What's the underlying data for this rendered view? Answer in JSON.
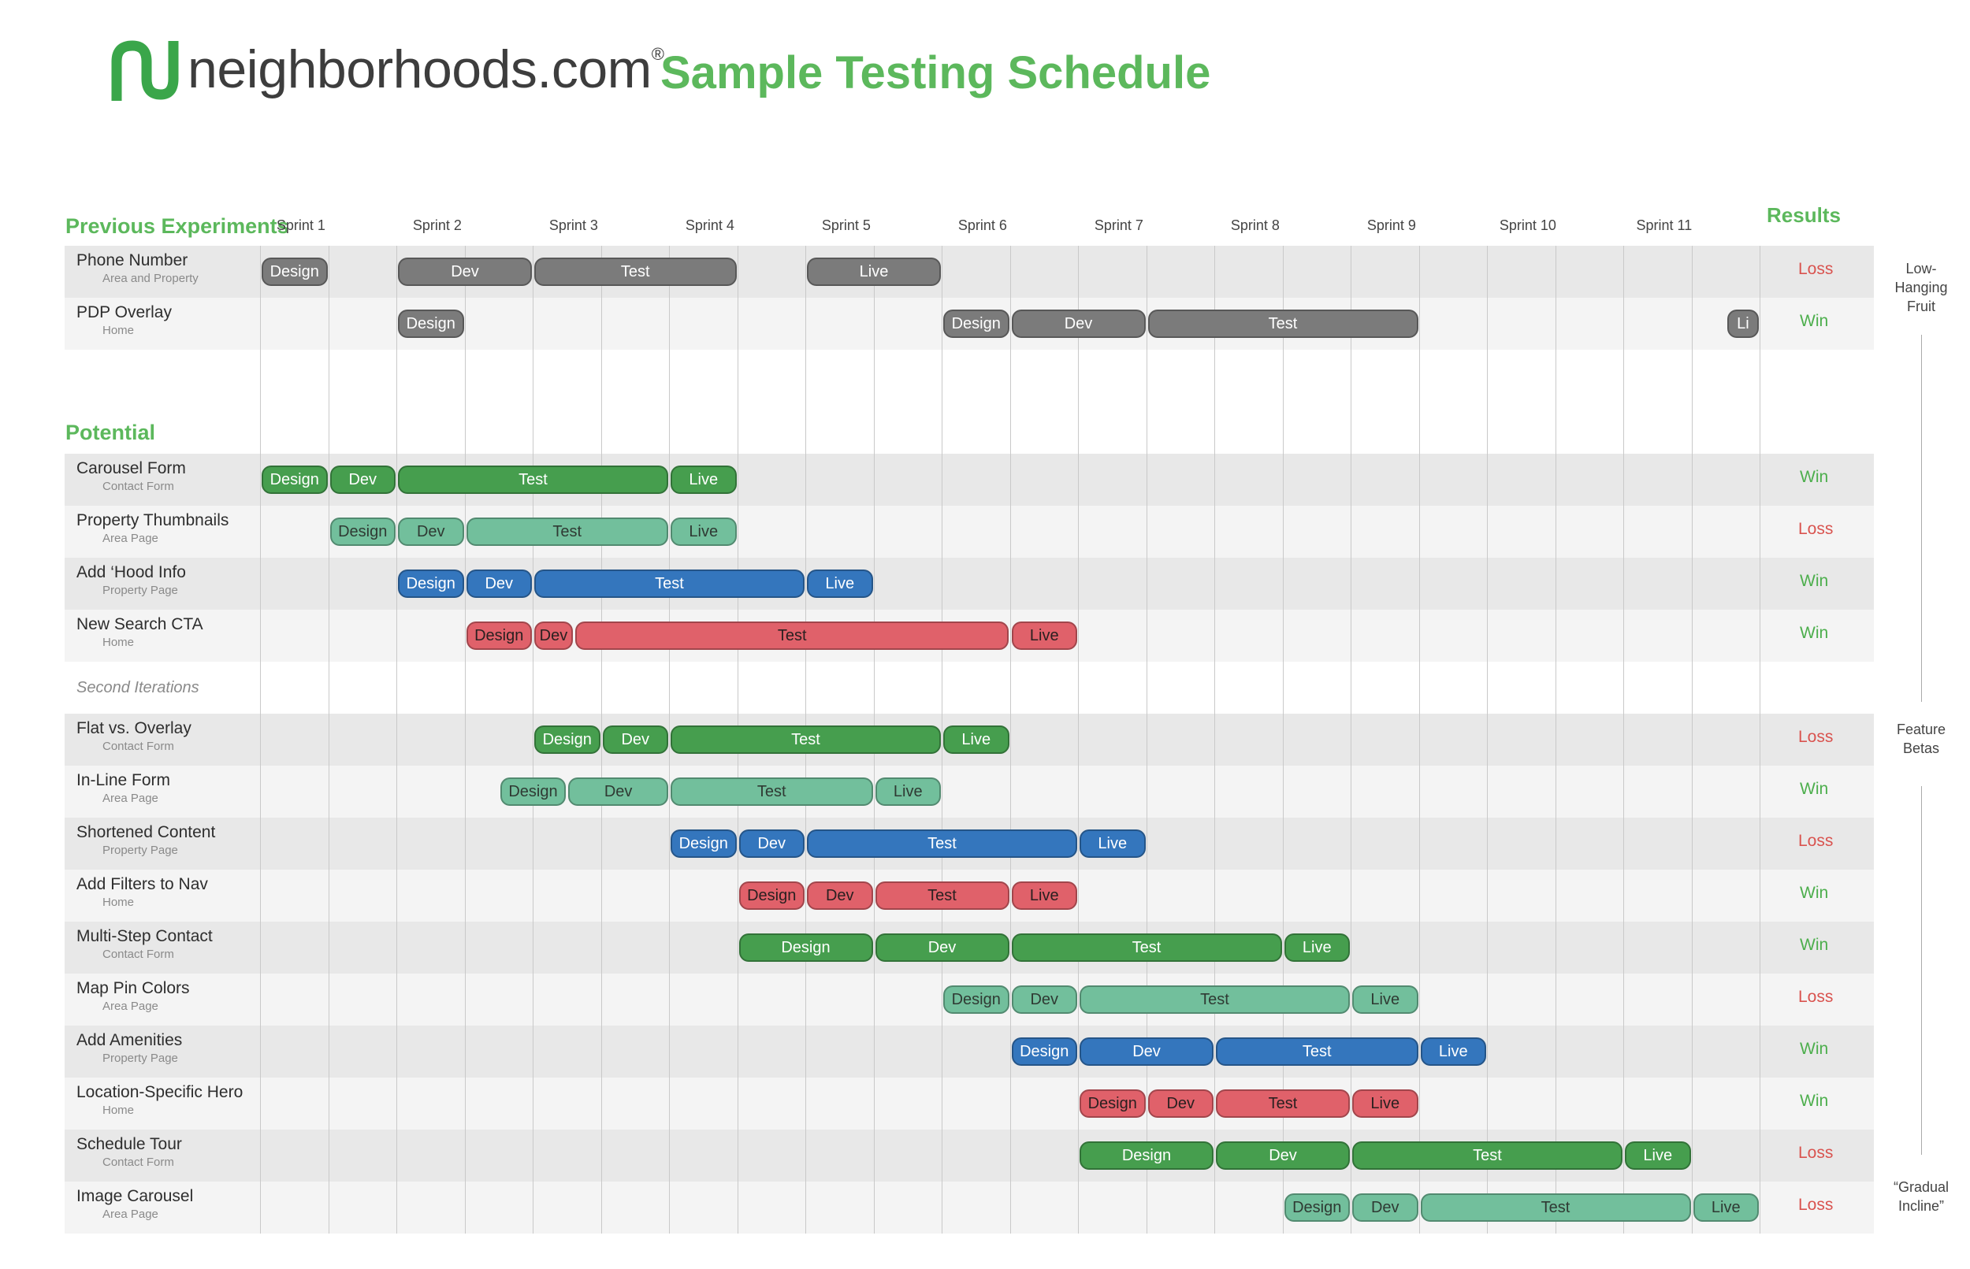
{
  "header": {
    "logo_text": "neighborhoods.com",
    "logo_mark": "®",
    "title": "Sample Testing Schedule"
  },
  "sections": {
    "previous": "Previous Experiments",
    "potential": "Potential",
    "second_iterations": "Second Iterations"
  },
  "sprints": [
    "Sprint 1",
    "Sprint 2",
    "Sprint 3",
    "Sprint 4",
    "Sprint 5",
    "Sprint 6",
    "Sprint 7",
    "Sprint 8",
    "Sprint 9",
    "Sprint 10",
    "Sprint 11"
  ],
  "results_header": "Results",
  "colors": {
    "gray": "#7b7b7b",
    "dark_green": "#469e4e",
    "light_green": "#72bf9c",
    "blue": "#3476bd",
    "red": "#e0616a",
    "win": "#4cae4c",
    "loss": "#d9534f",
    "title_green": "#5cb85c"
  },
  "rows": [
    {
      "name": "Phone Number",
      "sub": "Area and Property",
      "result": "Loss",
      "color": "gray",
      "bars": [
        {
          "label": "Design",
          "start": 0,
          "end": 0.5
        },
        {
          "label": "Dev",
          "start": 1,
          "end": 2
        },
        {
          "label": "Test",
          "start": 2,
          "end": 3.5
        },
        {
          "label": "Live",
          "start": 4,
          "end": 5
        }
      ]
    },
    {
      "name": "PDP Overlay",
      "sub": "Home",
      "result": "Win",
      "color": "gray",
      "bars": [
        {
          "label": "Design",
          "start": 1,
          "end": 1.5
        },
        {
          "label": "Design",
          "start": 5,
          "end": 5.5
        },
        {
          "label": "Dev",
          "start": 5.5,
          "end": 6.5
        },
        {
          "label": "Test",
          "start": 6.5,
          "end": 8.5
        },
        {
          "label": "Li",
          "start": 10.75,
          "end": 11
        }
      ]
    },
    {
      "name": "Carousel Form",
      "sub": "Contact Form",
      "result": "Win",
      "color": "dark_green",
      "bars": [
        {
          "label": "Design",
          "start": 0,
          "end": 0.5
        },
        {
          "label": "Dev",
          "start": 0.5,
          "end": 1
        },
        {
          "label": "Test",
          "start": 1,
          "end": 3
        },
        {
          "label": "Live",
          "start": 3,
          "end": 3.5
        }
      ]
    },
    {
      "name": "Property Thumbnails",
      "sub": "Area Page",
      "result": "Loss",
      "color": "light_green",
      "bars": [
        {
          "label": "Design",
          "start": 0.5,
          "end": 1
        },
        {
          "label": "Dev",
          "start": 1,
          "end": 1.5
        },
        {
          "label": "Test",
          "start": 1.5,
          "end": 3
        },
        {
          "label": "Live",
          "start": 3,
          "end": 3.5
        }
      ]
    },
    {
      "name": "Add ‘Hood Info",
      "sub": "Property Page",
      "result": "Win",
      "color": "blue",
      "bars": [
        {
          "label": "Design",
          "start": 1,
          "end": 1.5
        },
        {
          "label": "Dev",
          "start": 1.5,
          "end": 2
        },
        {
          "label": "Test",
          "start": 2,
          "end": 4
        },
        {
          "label": "Live",
          "start": 4,
          "end": 4.5
        }
      ]
    },
    {
      "name": "New Search CTA",
      "sub": "Home",
      "result": "Win",
      "color": "red",
      "bars": [
        {
          "label": "Design",
          "start": 1.5,
          "end": 2
        },
        {
          "label": "Dev",
          "start": 2,
          "end": 2.3
        },
        {
          "label": "Test",
          "start": 2.3,
          "end": 5.5
        },
        {
          "label": "Live",
          "start": 5.5,
          "end": 6
        }
      ]
    },
    {
      "name": "Flat vs. Overlay",
      "sub": "Contact Form",
      "result": "Loss",
      "color": "dark_green",
      "bars": [
        {
          "label": "Design",
          "start": 2,
          "end": 2.5
        },
        {
          "label": "Dev",
          "start": 2.5,
          "end": 3
        },
        {
          "label": "Test",
          "start": 3,
          "end": 5
        },
        {
          "label": "Live",
          "start": 5,
          "end": 5.5
        }
      ]
    },
    {
      "name": "In-Line Form",
      "sub": "Area Page",
      "result": "Win",
      "color": "light_green",
      "bars": [
        {
          "label": "Design",
          "start": 1.75,
          "end": 2.25
        },
        {
          "label": "Dev",
          "start": 2.25,
          "end": 3
        },
        {
          "label": "Test",
          "start": 3,
          "end": 4.5
        },
        {
          "label": "Live",
          "start": 4.5,
          "end": 5
        }
      ]
    },
    {
      "name": "Shortened Content",
      "sub": "Property Page",
      "result": "Loss",
      "color": "blue",
      "bars": [
        {
          "label": "Design",
          "start": 3,
          "end": 3.5
        },
        {
          "label": "Dev",
          "start": 3.5,
          "end": 4
        },
        {
          "label": "Test",
          "start": 4,
          "end": 6
        },
        {
          "label": "Live",
          "start": 6,
          "end": 6.5
        }
      ]
    },
    {
      "name": "Add Filters to Nav",
      "sub": "Home",
      "result": "Win",
      "color": "red",
      "bars": [
        {
          "label": "Design",
          "start": 3.5,
          "end": 4
        },
        {
          "label": "Dev",
          "start": 4,
          "end": 4.5
        },
        {
          "label": "Test",
          "start": 4.5,
          "end": 5.5
        },
        {
          "label": "Live",
          "start": 5.5,
          "end": 6
        }
      ]
    },
    {
      "name": "Multi-Step Contact",
      "sub": "Contact Form",
      "result": "Win",
      "color": "dark_green",
      "bars": [
        {
          "label": "Design",
          "start": 3.5,
          "end": 4.5
        },
        {
          "label": "Dev",
          "start": 4.5,
          "end": 5.5
        },
        {
          "label": "Test",
          "start": 5.5,
          "end": 7.5
        },
        {
          "label": "Live",
          "start": 7.5,
          "end": 8
        }
      ]
    },
    {
      "name": "Map Pin Colors",
      "sub": "Area Page",
      "result": "Loss",
      "color": "light_green",
      "bars": [
        {
          "label": "Design",
          "start": 5,
          "end": 5.5
        },
        {
          "label": "Dev",
          "start": 5.5,
          "end": 6
        },
        {
          "label": "Test",
          "start": 6,
          "end": 8
        },
        {
          "label": "Live",
          "start": 8,
          "end": 8.5
        }
      ]
    },
    {
      "name": "Add Amenities",
      "sub": "Property Page",
      "result": "Win",
      "color": "blue",
      "bars": [
        {
          "label": "Design",
          "start": 5.5,
          "end": 6
        },
        {
          "label": "Dev",
          "start": 6,
          "end": 7
        },
        {
          "label": "Test",
          "start": 7,
          "end": 8.5
        },
        {
          "label": "Live",
          "start": 8.5,
          "end": 9
        }
      ]
    },
    {
      "name": "Location-Specific Hero",
      "sub": "Home",
      "result": "Win",
      "color": "red",
      "bars": [
        {
          "label": "Design",
          "start": 6,
          "end": 6.5
        },
        {
          "label": "Dev",
          "start": 6.5,
          "end": 7
        },
        {
          "label": "Test",
          "start": 7,
          "end": 8
        },
        {
          "label": "Live",
          "start": 8,
          "end": 8.5
        }
      ]
    },
    {
      "name": "Schedule Tour",
      "sub": "Contact Form",
      "result": "Loss",
      "color": "dark_green",
      "bars": [
        {
          "label": "Design",
          "start": 6,
          "end": 7
        },
        {
          "label": "Dev",
          "start": 7,
          "end": 8
        },
        {
          "label": "Test",
          "start": 8,
          "end": 10
        },
        {
          "label": "Live",
          "start": 10,
          "end": 10.5
        }
      ]
    },
    {
      "name": "Image Carousel",
      "sub": "Area Page",
      "result": "Loss",
      "color": "light_green",
      "bars": [
        {
          "label": "Design",
          "start": 7.5,
          "end": 8
        },
        {
          "label": "Dev",
          "start": 8,
          "end": 8.5
        },
        {
          "label": "Test",
          "start": 8.5,
          "end": 10.5
        },
        {
          "label": "Live",
          "start": 10.5,
          "end": 11
        }
      ]
    }
  ],
  "notes": {
    "low_hanging": "Low-\nHanging\nFruit",
    "feature_betas": "Feature\nBetas",
    "gradual_incline": "“Gradual\nIncline”"
  }
}
